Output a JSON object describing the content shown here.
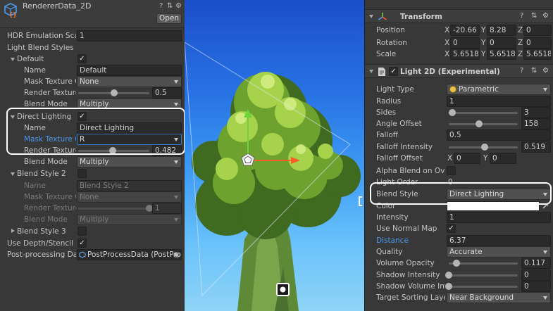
{
  "left": {
    "asset_title": "RendererData_2D",
    "open_label": "Open",
    "hdr_emulation_label": "HDR Emulation Scale",
    "hdr_emulation_value": "1",
    "light_blend_styles_label": "Light Blend Styles",
    "default_label": "Default",
    "default_name_label": "Name",
    "default_name_value": "Default",
    "default_mask_label": "Mask Texture Channel",
    "default_mask_value": "None",
    "default_render_label": "Render Texture Scale",
    "default_render_value": "0.5",
    "default_render_level": 0.5,
    "default_blend_label": "Blend Mode",
    "default_blend_value": "Multiply",
    "direct_label": "Direct Lighting",
    "direct_name_label": "Name",
    "direct_name_value": "Direct Lighting",
    "direct_mask_label": "Mask Texture Channel",
    "direct_mask_value": "R",
    "direct_render_label": "Render Texture Scale",
    "direct_render_value": "0.482",
    "direct_render_level": 0.482,
    "direct_blend_label": "Blend Mode",
    "direct_blend_value": "Multiply",
    "bs2_label": "Blend Style 2",
    "bs2_name_label": "Name",
    "bs2_name_value": "Blend Style 2",
    "bs2_mask_label": "Mask Texture Channel",
    "bs2_mask_value": "None",
    "bs2_render_label": "Render Texture Scale",
    "bs2_render_value": "1",
    "bs2_render_level": 1,
    "bs2_blend_label": "Blend Mode",
    "bs2_blend_value": "Multiply",
    "bs3_label": "Blend Style 3",
    "depth_label": "Use Depth/Stencil Buffer",
    "post_label": "Post-processing Data",
    "post_value": "PostProcessData (PostProcessData)"
  },
  "transform": {
    "title": "Transform",
    "position_label": "Position",
    "position": {
      "x": "-20.66",
      "y": "8.28",
      "z": "0"
    },
    "rotation_label": "Rotation",
    "rotation": {
      "x": "0",
      "y": "0",
      "z": "0"
    },
    "scale_label": "Scale",
    "scale": {
      "x": "5.6518",
      "y": "5.6518",
      "z": "5.6518"
    },
    "axis_x": "X",
    "axis_y": "Y",
    "axis_z": "Z"
  },
  "light2d": {
    "title": "Light 2D (Experimental)",
    "light_type_label": "Light Type",
    "light_type_value": "Parametric",
    "radius_label": "Radius",
    "radius_value": "1",
    "sides_label": "Sides",
    "sides_value": "3",
    "sides_level": 0.05,
    "angle_label": "Angle Offset",
    "angle_value": "158",
    "angle_level": 0.439,
    "falloff_label": "Falloff",
    "falloff_value": "0.5",
    "falloff_intensity_label": "Falloff Intensity",
    "falloff_intensity_value": "0.519",
    "falloff_intensity_level": 0.519,
    "falloff_offset_label": "Falloff Offset",
    "falloff_offset_x": "0",
    "falloff_offset_y": "0",
    "alpha_blend_label": "Alpha Blend on Overlap",
    "light_order_label": "Light Order",
    "light_order_value": "0",
    "blend_style_label": "Blend Style",
    "blend_style_value": "Direct Lighting",
    "color_label": "Color",
    "color_value": "#ffffff",
    "intensity_label": "Intensity",
    "intensity_value": "1",
    "normal_map_label": "Use Normal Map",
    "distance_label": "Distance",
    "distance_value": "6.37",
    "quality_label": "Quality",
    "quality_value": "Accurate",
    "volume_label": "Volume Opacity",
    "volume_value": "0.117",
    "volume_level": 0.117,
    "shadow_intensity_label": "Shadow Intensity",
    "shadow_intensity_value": "0",
    "shadow_intensity_level": 0,
    "shadow_volume_label": "Shadow Volume Intensity",
    "shadow_volume_value": "0",
    "shadow_volume_level": 0,
    "sorting_label": "Target Sorting Layers",
    "sorting_value": "Near Background"
  },
  "glyphs": {
    "check": "✓",
    "help": "?",
    "preset": "⇅",
    "gear": "⚙",
    "dot": "◉"
  }
}
